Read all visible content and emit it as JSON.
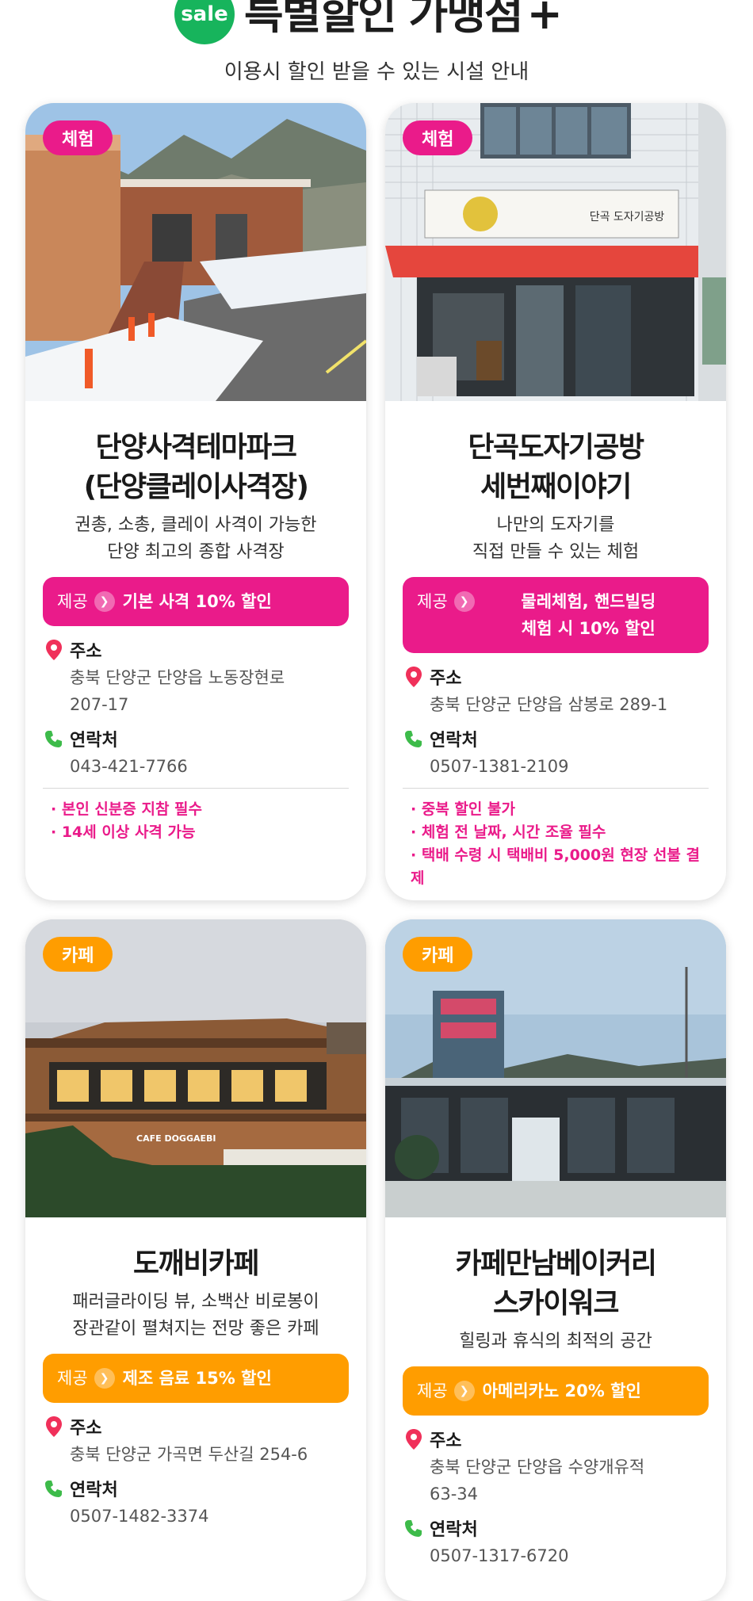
{
  "header": {
    "badge": "sale",
    "title": "특별할인 가맹점",
    "plus": "+",
    "subtitle": "이용시 할인 받을 수 있는 시설 안내"
  },
  "labels": {
    "offer": "제공",
    "address": "주소",
    "contact": "연락처"
  },
  "colors": {
    "pink": "#ea1b8a",
    "orange": "#ff9d00",
    "green": "#17b45c"
  },
  "cards": [
    {
      "tag": "체험",
      "name1": "단양사격테마파크",
      "name2": "(단양클레이사격장)",
      "desc1": "권총, 소총, 클레이 사격이 가능한",
      "desc2": "단양 최고의 종합 사격장",
      "offer1": "기본 사격 10% 할인",
      "address1": "충북 단양군 단양읍 노동장현로",
      "address2": "207-17",
      "phone": "043-421-7766",
      "notes": [
        "· 본인 신분증 지참 필수",
        "· 14세 이상 사격 가능"
      ]
    },
    {
      "tag": "체험",
      "name1": "단곡도자기공방",
      "name2": "세번째이야기",
      "desc1": "나만의 도자기를",
      "desc2": "직접 만들 수 있는 체험",
      "offer1": "물레체험, 핸드빌딩",
      "offer2": "체험 시 10% 할인",
      "address1": "충북 단양군 단양읍 삼봉로 289-1",
      "phone": "0507-1381-2109",
      "notes": [
        "· 중복 할인 불가",
        "· 체험 전 날짜, 시간 조율 필수",
        "· 택배 수령 시 택배비 5,000원 현장 선불 결제"
      ],
      "shop_sign": "단곡 도자기공방"
    },
    {
      "tag": "카페",
      "name1": "도깨비카페",
      "desc1": "패러글라이딩 뷰, 소백산 비로봉이",
      "desc2": "장관같이 펼쳐지는 전망 좋은 카페",
      "offer1": "제조 음료 15% 할인",
      "address1": "충북 단양군 가곡면 두산길 254-6",
      "phone": "0507-1482-3374",
      "cafe_sign": "CAFE DOGGAEBI"
    },
    {
      "tag": "카페",
      "name1": "카페만남베이커리",
      "name2": "스카이워크",
      "desc1": "힐링과 휴식의 최적의 공간",
      "offer1": "아메리카노 20% 할인",
      "address1": "충북 단양군 단양읍 수양개유적",
      "address2": "63-34",
      "phone": "0507-1317-6720"
    }
  ]
}
